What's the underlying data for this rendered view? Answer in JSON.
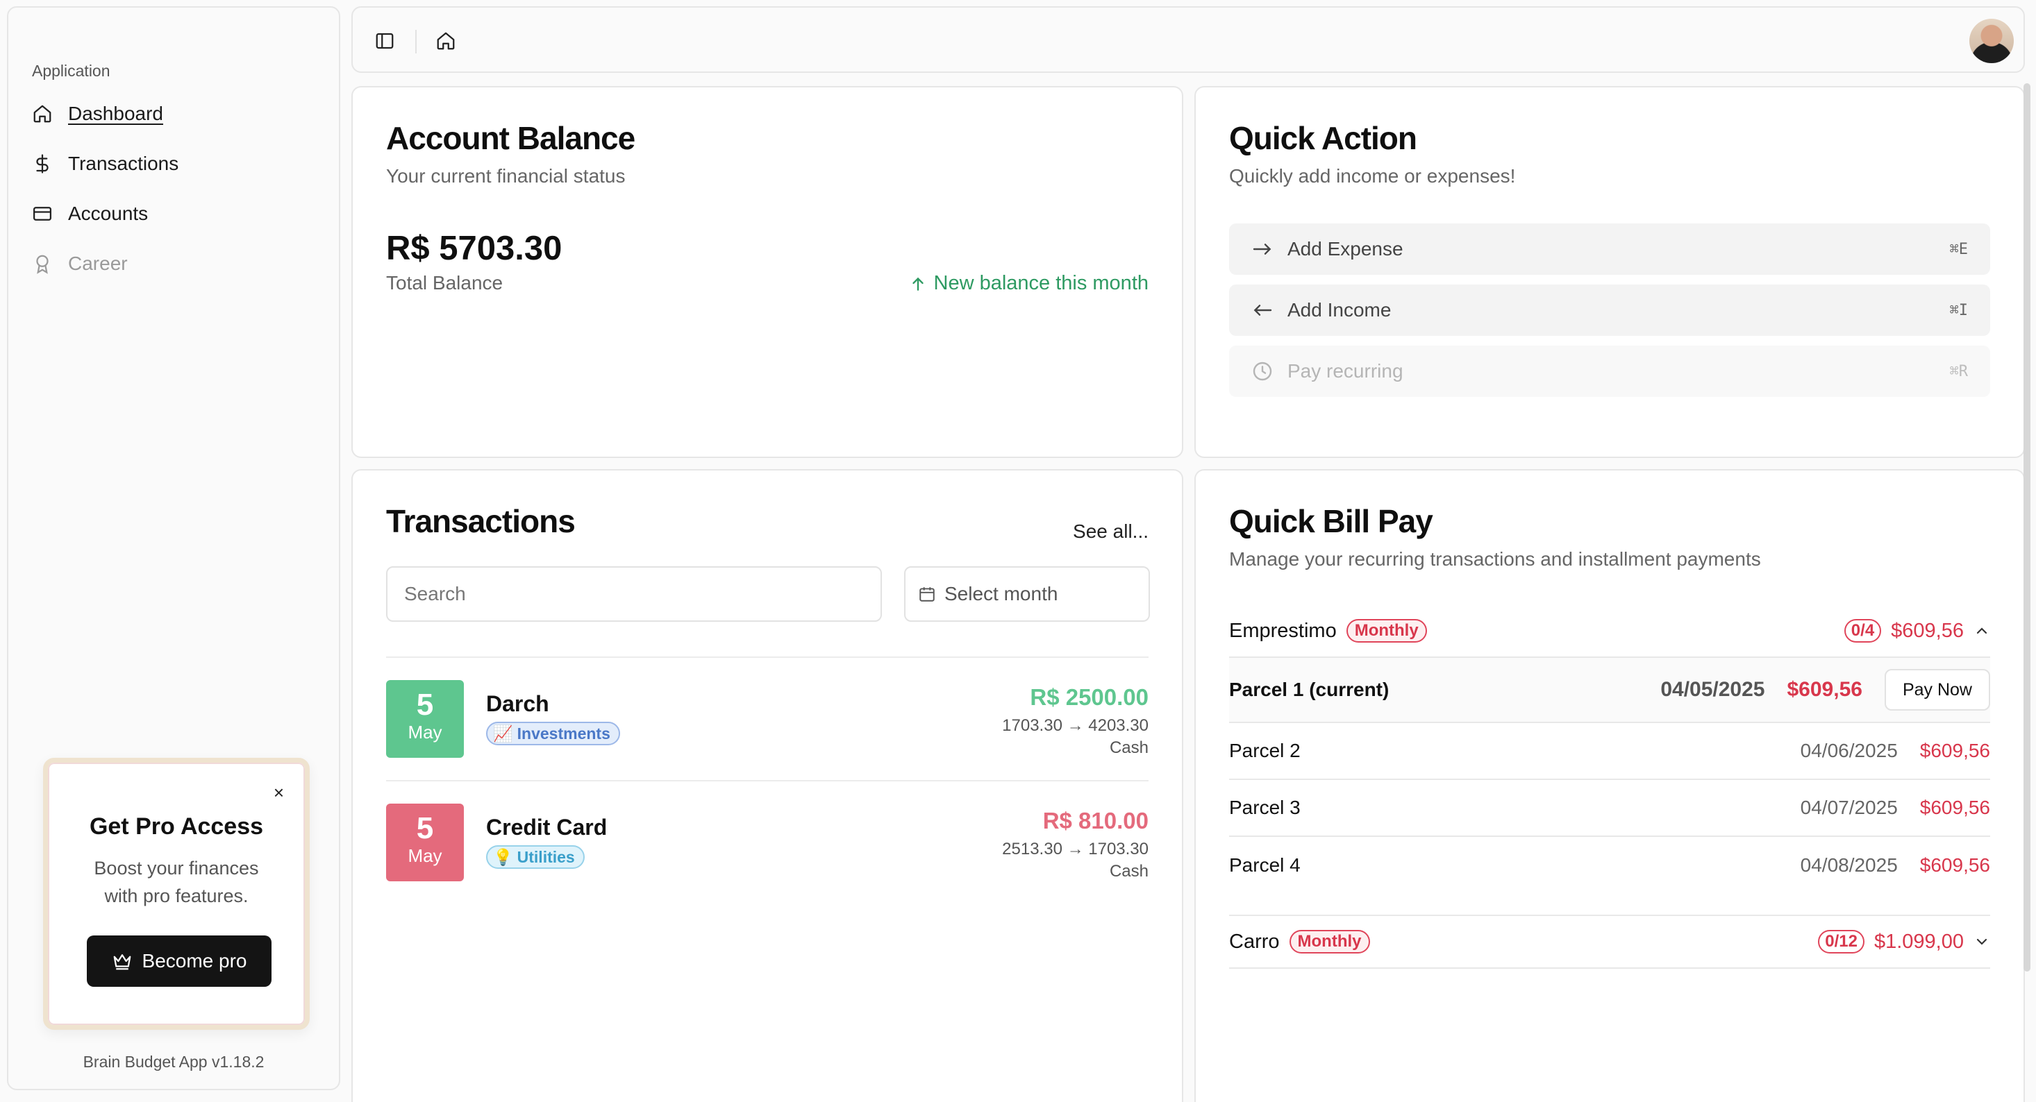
{
  "sidebar": {
    "group_label": "Application",
    "items": [
      {
        "label": "Dashboard",
        "icon": "home-icon"
      },
      {
        "label": "Transactions",
        "icon": "dollar-icon"
      },
      {
        "label": "Accounts",
        "icon": "credit-card-icon"
      },
      {
        "label": "Career",
        "icon": "award-icon"
      }
    ],
    "promo": {
      "close": "×",
      "title": "Get Pro Access",
      "text": "Boost your finances with pro features.",
      "button": "Become pro"
    },
    "version": "Brain Budget App v1.18.2"
  },
  "balance": {
    "title": "Account Balance",
    "subtitle": "Your current financial status",
    "amount": "R$ 5703.30",
    "label": "Total Balance",
    "trend": "New balance this month"
  },
  "quick_action": {
    "title": "Quick Action",
    "subtitle": "Quickly add income or expenses!",
    "actions": [
      {
        "label": "Add Expense",
        "shortcut": "⌘E"
      },
      {
        "label": "Add Income",
        "shortcut": "⌘I"
      },
      {
        "label": "Pay recurring",
        "shortcut": "⌘R"
      }
    ]
  },
  "transactions": {
    "title": "Transactions",
    "see_all": "See all...",
    "search_placeholder": "Search",
    "month_placeholder": "Select month",
    "items": [
      {
        "day": "5",
        "month": "May",
        "name": "Darch",
        "tag": "Investments",
        "tag_icon": "📈",
        "amount": "R$ 2500.00",
        "flow": "1703.30 → 4203.30",
        "account": "Cash"
      },
      {
        "day": "5",
        "month": "May",
        "name": "Credit Card",
        "tag": "Utilities",
        "tag_icon": "💡",
        "amount": "R$ 810.00",
        "flow": "2513.30 → 1703.30",
        "account": "Cash"
      }
    ]
  },
  "bills": {
    "title": "Quick Bill Pay",
    "subtitle": "Manage your recurring transactions and installment payments",
    "groups": [
      {
        "name": "Emprestimo",
        "badge": "Monthly",
        "count": "0/4",
        "amount": "$609,56",
        "parcels": [
          {
            "name": "Parcel 1 (current)",
            "date": "04/05/2025",
            "amount": "$609,56",
            "action": "Pay Now"
          },
          {
            "name": "Parcel 2",
            "date": "04/06/2025",
            "amount": "$609,56"
          },
          {
            "name": "Parcel 3",
            "date": "04/07/2025",
            "amount": "$609,56"
          },
          {
            "name": "Parcel 4",
            "date": "04/08/2025",
            "amount": "$609,56"
          }
        ]
      },
      {
        "name": "Carro",
        "badge": "Monthly",
        "count": "0/12",
        "amount": "$1.099,00"
      }
    ]
  },
  "colors": {
    "positive": "#2e9a62",
    "negative": "#d8374c",
    "income_tile": "#5ec68f",
    "expense_tile": "#e46a7c"
  }
}
